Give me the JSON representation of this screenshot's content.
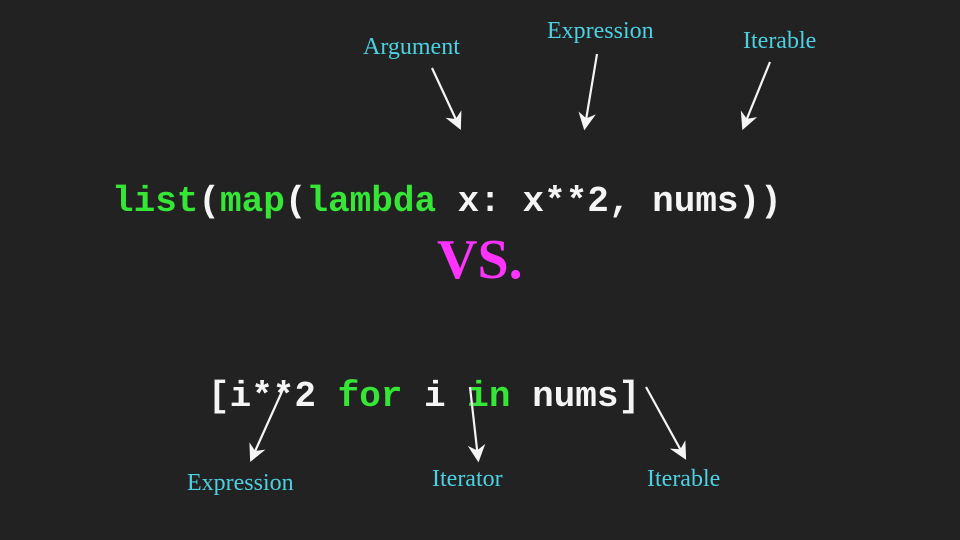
{
  "labels": {
    "top": {
      "argument": "Argument",
      "expression": "Expression",
      "iterable": "Iterable"
    },
    "bottom": {
      "expression": "Expression",
      "iterator": "Iterator",
      "iterable": "Iterable"
    }
  },
  "code1": {
    "t1": "list",
    "t2": "(",
    "t3": "map",
    "t4": "(",
    "t5": "lambda",
    "t6": " x: x**2, nums))"
  },
  "vs": "VS.",
  "code2": {
    "t1": "[i**2 ",
    "t2": "for",
    "t3": " i ",
    "t4": "in",
    "t5": " nums]"
  }
}
